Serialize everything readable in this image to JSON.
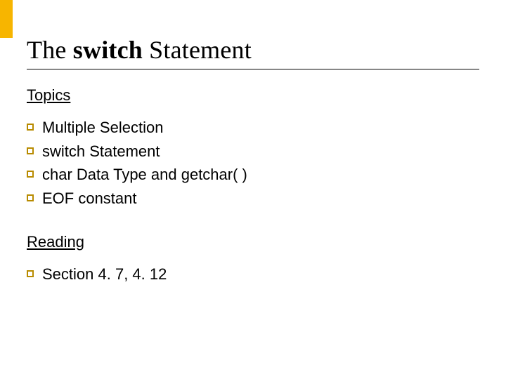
{
  "title": {
    "pre": "The ",
    "bold": "switch",
    "post": " Statement"
  },
  "sections": {
    "topics": {
      "heading": "Topics",
      "items": [
        "Multiple Selection",
        "switch Statement",
        "char Data Type and getchar( )",
        "EOF constant"
      ]
    },
    "reading": {
      "heading": "Reading",
      "items": [
        "Section 4. 7, 4. 12"
      ]
    }
  }
}
